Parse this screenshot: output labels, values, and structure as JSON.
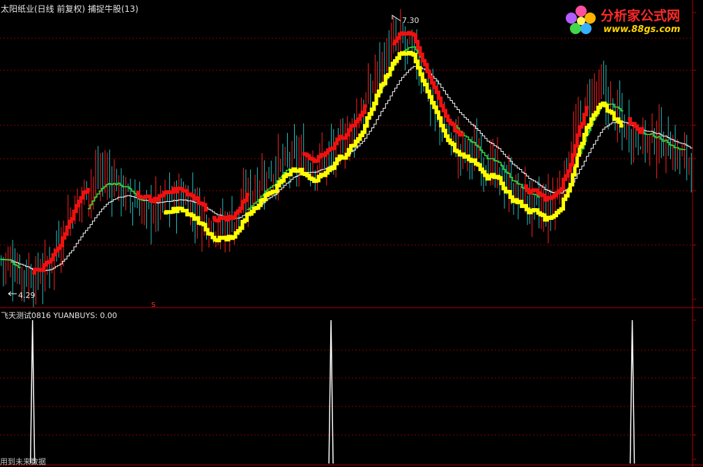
{
  "main_panel": {
    "title": "太阳纸业(日线 前复权) 捕捉牛股(13)",
    "high_label": "7.30",
    "low_label": "4.29",
    "marker": "S"
  },
  "sub_panel": {
    "title": "飞天测试0816  YUANBUYS: 0.00"
  },
  "footer": {
    "text": "用到未来数据"
  },
  "logo": {
    "name": "分析家公式网",
    "url": "www.88gs.com"
  },
  "colors": {
    "background": "#000000",
    "grid": "#8b0000",
    "separator": "#b40000",
    "up": "#ff2020",
    "down": "#22c0c0",
    "line_red": "#ee1111",
    "line_yellow": "#ffff00",
    "line_green": "#33dd33",
    "line_white": "#ffffff",
    "signal": "#ffffff"
  },
  "chart_data": [
    {
      "type": "candlestick",
      "title": "太阳纸业(日线 前复权) 捕捉牛股(13)",
      "series": [
        {
          "name": "price_path",
          "values": [
            4.55,
            4.45,
            4.38,
            4.29,
            4.42,
            4.7,
            5.05,
            5.3,
            5.5,
            5.62,
            5.55,
            5.4,
            5.25,
            5.15,
            5.2,
            5.3,
            5.35,
            5.25,
            5.1,
            4.98,
            4.95,
            5.05,
            5.3,
            5.5,
            5.62,
            5.7,
            5.8,
            5.78,
            5.72,
            5.8,
            5.9,
            6.1,
            6.3,
            6.6,
            7.0,
            7.2,
            7.3,
            7.15,
            6.8,
            6.4,
            6.1,
            5.95,
            5.9,
            5.85,
            5.7,
            5.55,
            5.4,
            5.3,
            5.2,
            5.15,
            5.35,
            5.8,
            6.3,
            6.6,
            6.65,
            6.4,
            6.2,
            6.1,
            6.05,
            6.05,
            5.95,
            5.85,
            5.8
          ]
        },
        {
          "name": "yellow_step_line",
          "segments": [
            [
              0.24,
              0.55
            ],
            [
              0.35,
              0.62
            ],
            [
              0.47,
              0.8
            ],
            [
              0.57,
              0.9
            ]
          ],
          "range": [
            4.29,
            7.3
          ]
        },
        {
          "name": "red_step_line",
          "segments": [
            [
              0.05,
              0.13
            ],
            [
              0.2,
              0.3
            ],
            [
              0.31,
              0.36
            ],
            [
              0.44,
              0.53
            ],
            [
              0.57,
              0.67
            ],
            [
              0.76,
              0.85
            ],
            [
              0.91,
              0.93
            ]
          ]
        },
        {
          "name": "green_step_line",
          "segments": [
            [
              0.0,
              0.03
            ],
            [
              0.13,
              0.21
            ],
            [
              0.36,
              0.42
            ],
            [
              0.55,
              0.62
            ],
            [
              0.66,
              0.78
            ],
            [
              0.84,
              0.9
            ],
            [
              0.93,
              0.99
            ]
          ]
        },
        {
          "name": "white_step_line",
          "segments": [
            [
              0.0,
              1.0
            ]
          ]
        }
      ],
      "annotations": [
        {
          "text": "7.30",
          "kind": "high"
        },
        {
          "text": "4.29",
          "kind": "low"
        },
        {
          "text": "S",
          "kind": "sell_marker"
        }
      ]
    },
    {
      "type": "line",
      "title": "飞天测试0816  YUANBUYS: 0.00",
      "series": [
        {
          "name": "YUANBUYS",
          "spikes_at_fraction": [
            0.047,
            0.478,
            0.913
          ],
          "spike_value": 1,
          "base_value": 0
        }
      ],
      "ylim": [
        0,
        1
      ]
    }
  ]
}
